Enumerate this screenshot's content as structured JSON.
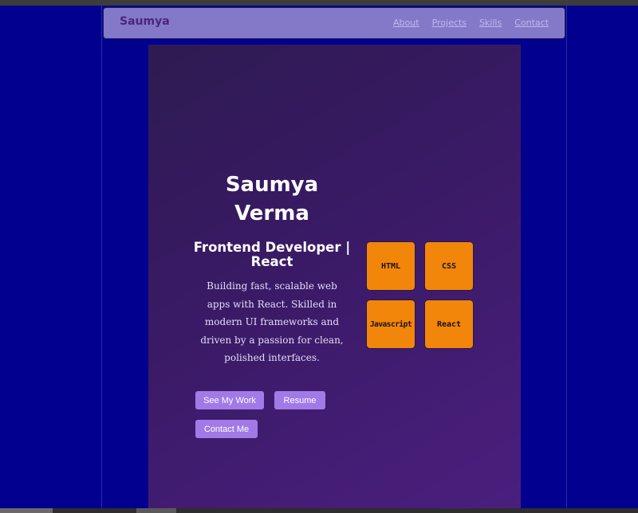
{
  "navbar": {
    "brand": "Saumya",
    "links": [
      "About",
      "Projects",
      "Skills",
      "Contact"
    ]
  },
  "hero": {
    "name_line1": "Saumya",
    "name_line2": "Verma",
    "role": "Frontend Developer | React",
    "bio": "Building fast, scalable web apps with React. Skilled in modern UI frameworks and driven by a passion for clean, polished interfaces.",
    "buttons": {
      "work": "See My Work",
      "resume": "Resume",
      "contact": "Contact Me"
    }
  },
  "skills": [
    "HTML",
    "CSS",
    "Javascript",
    "React"
  ],
  "colors": {
    "background": "#02008f",
    "navbar": "#8479c8",
    "accent_button": "#a17ae8",
    "skill_tile": "#f2860b"
  }
}
